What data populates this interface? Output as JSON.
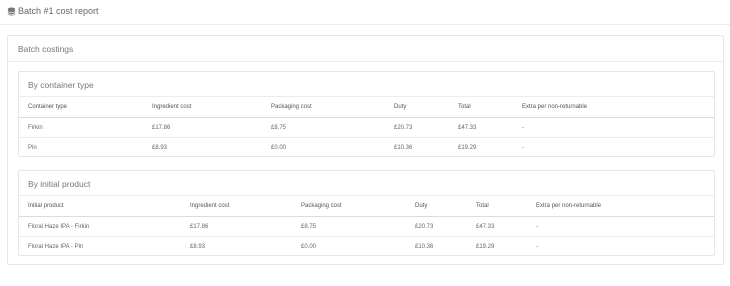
{
  "header": {
    "title": "Batch #1 cost report"
  },
  "panel": {
    "title": "Batch costings"
  },
  "sections": [
    {
      "title": "By container type",
      "columns": [
        "Container type",
        "Ingredient cost",
        "Packaging cost",
        "Duty",
        "Total",
        "Extra per non-returnable"
      ],
      "rows": [
        [
          "Firkin",
          "£17.86",
          "£8.75",
          "£20.73",
          "£47.33",
          "-"
        ],
        [
          "Pin",
          "£8.93",
          "£0.00",
          "£10.36",
          "£19.29",
          "-"
        ]
      ]
    },
    {
      "title": "By initial product",
      "columns": [
        "Initial product",
        "Ingredient cost",
        "Packaging cost",
        "Duty",
        "Total",
        "Extra per non-returnable"
      ],
      "rows": [
        [
          "Floral Haze IPA - Firkin",
          "£17.86",
          "£8.75",
          "£20.73",
          "£47.33",
          "-"
        ],
        [
          "Floral Haze IPA - Pin",
          "£8.93",
          "£0.00",
          "£10.36",
          "£19.29",
          "-"
        ]
      ]
    }
  ]
}
